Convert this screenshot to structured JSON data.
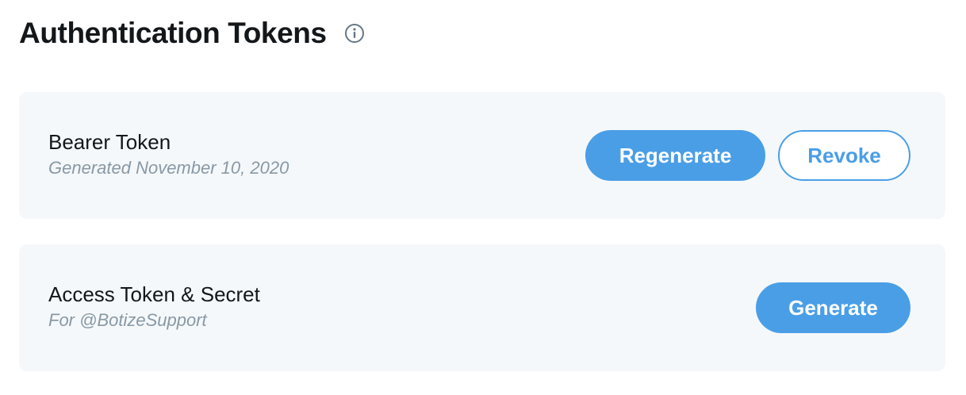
{
  "header": {
    "title": "Authentication Tokens",
    "info_icon": "info-circle-icon"
  },
  "colors": {
    "accent": "#4a9ee6",
    "card_background": "#f5f8fa",
    "subtitle_gray": "#8899a6",
    "title_text": "#14171a"
  },
  "tokens": [
    {
      "title": "Bearer Token",
      "subtitle": "Generated November 10, 2020",
      "buttons": {
        "regenerate_label": "Regenerate",
        "revoke_label": "Revoke"
      }
    },
    {
      "title": "Access Token & Secret",
      "subtitle": "For @BotizeSupport",
      "buttons": {
        "generate_label": "Generate"
      }
    }
  ]
}
